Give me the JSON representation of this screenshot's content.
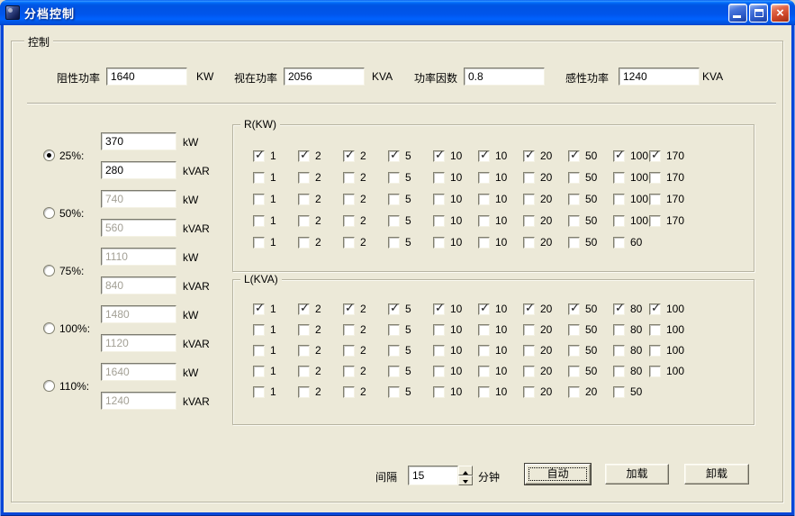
{
  "colors": {
    "titlebar_blue": "#0054E3",
    "frame_blue": "#0847D8",
    "client_bg": "#ECE9D8",
    "close_red": "#CC4527",
    "disabled_text": "#A3A095"
  },
  "titlebar": {
    "title": "分档控制",
    "close_glyph": "×"
  },
  "group_control": {
    "label": "控制"
  },
  "power_fields": [
    {
      "label": "阻性功率",
      "value": "1640",
      "unit": "KW"
    },
    {
      "label": "视在功率",
      "value": "2056",
      "unit": "KVA"
    },
    {
      "label": "功率因数",
      "value": "0.8",
      "unit": ""
    },
    {
      "label": "感性功率",
      "value": "1240",
      "unit": "KVA"
    }
  ],
  "levels": {
    "kw_unit": "kW",
    "kvar_unit": "kVAR",
    "items": [
      {
        "label": "25%:",
        "selected": true,
        "enabled": true,
        "kw": "370",
        "kvar": "280"
      },
      {
        "label": "50%:",
        "selected": false,
        "enabled": false,
        "kw": "740",
        "kvar": "560"
      },
      {
        "label": "75%:",
        "selected": false,
        "enabled": false,
        "kw": "1110",
        "kvar": "840"
      },
      {
        "label": "100%:",
        "selected": false,
        "enabled": false,
        "kw": "1480",
        "kvar": "1120"
      },
      {
        "label": "110%:",
        "selected": false,
        "enabled": false,
        "kw": "1640",
        "kvar": "1240"
      }
    ]
  },
  "r_group": {
    "label": "R(KW)",
    "check_glyph": "✓",
    "rows": [
      {
        "checked": true,
        "values": [
          "1",
          "2",
          "2",
          "5",
          "10",
          "10",
          "20",
          "50",
          "100",
          "170"
        ]
      },
      {
        "checked": false,
        "values": [
          "1",
          "2",
          "2",
          "5",
          "10",
          "10",
          "20",
          "50",
          "100",
          "170"
        ]
      },
      {
        "checked": false,
        "values": [
          "1",
          "2",
          "2",
          "5",
          "10",
          "10",
          "20",
          "50",
          "100",
          "170"
        ]
      },
      {
        "checked": false,
        "values": [
          "1",
          "2",
          "2",
          "5",
          "10",
          "10",
          "20",
          "50",
          "100",
          "170"
        ]
      },
      {
        "checked": false,
        "values": [
          "1",
          "2",
          "2",
          "5",
          "10",
          "10",
          "20",
          "50",
          "60"
        ]
      }
    ]
  },
  "l_group": {
    "label": "L(KVA)",
    "check_glyph": "✓",
    "rows": [
      {
        "checked": true,
        "values": [
          "1",
          "2",
          "2",
          "5",
          "10",
          "10",
          "20",
          "50",
          "80",
          "100"
        ]
      },
      {
        "checked": false,
        "values": [
          "1",
          "2",
          "2",
          "5",
          "10",
          "10",
          "20",
          "50",
          "80",
          "100"
        ]
      },
      {
        "checked": false,
        "values": [
          "1",
          "2",
          "2",
          "5",
          "10",
          "10",
          "20",
          "50",
          "80",
          "100"
        ]
      },
      {
        "checked": false,
        "values": [
          "1",
          "2",
          "2",
          "5",
          "10",
          "10",
          "20",
          "50",
          "80",
          "100"
        ]
      },
      {
        "checked": false,
        "values": [
          "1",
          "2",
          "2",
          "5",
          "10",
          "10",
          "20",
          "20",
          "50"
        ]
      }
    ]
  },
  "footer": {
    "interval_label": "间隔",
    "interval_value": "15",
    "interval_unit": "分钟",
    "buttons": [
      {
        "label": "自动",
        "default": true
      },
      {
        "label": "加载",
        "default": false
      },
      {
        "label": "卸载",
        "default": false
      }
    ]
  }
}
